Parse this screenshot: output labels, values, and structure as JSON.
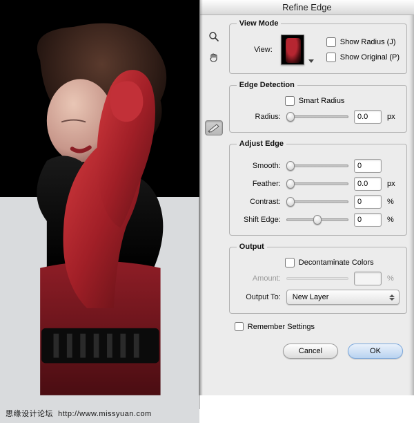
{
  "watermark": {
    "site": "思缘设计论坛",
    "url": "http://www.missyuan.com"
  },
  "dialog": {
    "title": "Refine Edge",
    "viewMode": {
      "legend": "View Mode",
      "viewLabel": "View:",
      "showRadius": "Show Radius (J)",
      "showOriginal": "Show Original (P)"
    },
    "edgeDetection": {
      "legend": "Edge Detection",
      "smartRadius": "Smart Radius",
      "radiusLabel": "Radius:",
      "radiusValue": "0.0",
      "radiusUnit": "px"
    },
    "adjustEdge": {
      "legend": "Adjust Edge",
      "smoothLabel": "Smooth:",
      "smoothValue": "0",
      "featherLabel": "Feather:",
      "featherValue": "0.0",
      "featherUnit": "px",
      "contrastLabel": "Contrast:",
      "contrastValue": "0",
      "contrastUnit": "%",
      "shiftLabel": "Shift Edge:",
      "shiftValue": "0",
      "shiftUnit": "%"
    },
    "output": {
      "legend": "Output",
      "decontaminate": "Decontaminate Colors",
      "amountLabel": "Amount:",
      "amountUnit": "%",
      "outputToLabel": "Output To:",
      "outputToValue": "New Layer"
    },
    "remember": "Remember Settings",
    "cancel": "Cancel",
    "ok": "OK"
  }
}
